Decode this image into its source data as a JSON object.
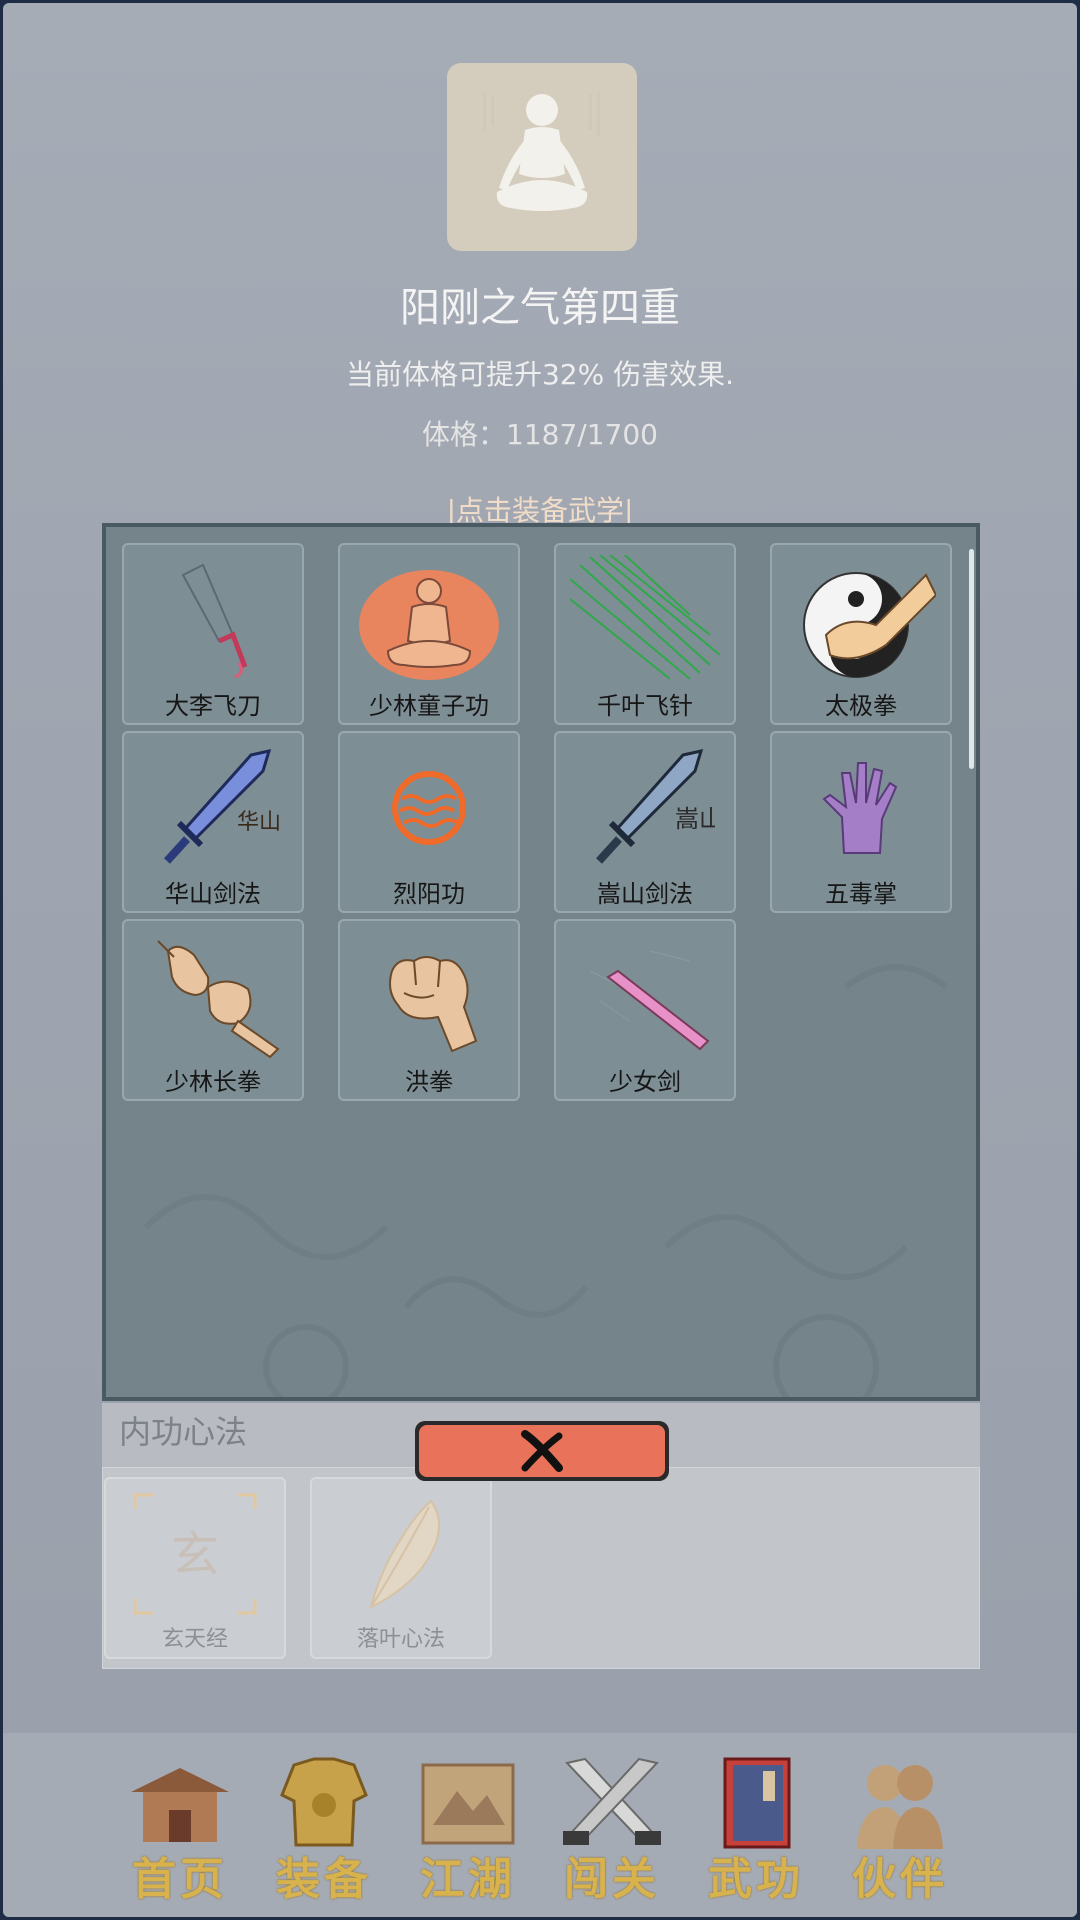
{
  "header": {
    "title": "阳刚之气第四重",
    "description": "当前体格可提升32% 伤害效果.",
    "stat_label": "体格：",
    "stat_value": "1187/1700",
    "equip_hint": "|点击装备武学|"
  },
  "skills": [
    {
      "name": "大李飞刀",
      "icon": "flying-knife-icon"
    },
    {
      "name": "少林童子功",
      "icon": "meditating-monk-icon"
    },
    {
      "name": "千叶飞针",
      "icon": "flying-needles-icon"
    },
    {
      "name": "太极拳",
      "icon": "taiji-fist-icon"
    },
    {
      "name": "华山剑法",
      "icon": "huashan-sword-icon",
      "glyph": "华山"
    },
    {
      "name": "烈阳功",
      "icon": "sun-orb-icon"
    },
    {
      "name": "嵩山剑法",
      "icon": "songshan-sword-icon",
      "glyph": "嵩山"
    },
    {
      "name": "五毒掌",
      "icon": "poison-palm-icon"
    },
    {
      "name": "少林长拳",
      "icon": "shaolin-fists-icon"
    },
    {
      "name": "洪拳",
      "icon": "fist-icon"
    },
    {
      "name": "少女剑",
      "icon": "pink-sword-icon"
    }
  ],
  "inner": {
    "title": "内功心法",
    "items": [
      {
        "name": "玄天经",
        "icon": "xuantian-scripture-icon",
        "glyph": "玄"
      },
      {
        "name": "落叶心法",
        "icon": "falling-leaf-icon"
      }
    ]
  },
  "close_button": {
    "icon": "close-x-icon"
  },
  "nav": [
    {
      "label": "首页",
      "icon": "temple-icon"
    },
    {
      "label": "装备",
      "icon": "armor-icon"
    },
    {
      "label": "江湖",
      "icon": "scroll-map-icon"
    },
    {
      "label": "闯关",
      "icon": "crossed-swords-icon"
    },
    {
      "label": "武功",
      "icon": "martial-book-icon"
    },
    {
      "label": "伙伴",
      "icon": "companions-icon"
    }
  ],
  "colors": {
    "background": "#a6acb6",
    "panel": "#75848a",
    "close_button": "#e8735a",
    "nav_text": "#d8b24c",
    "hint_text": "#f1dcc8"
  }
}
